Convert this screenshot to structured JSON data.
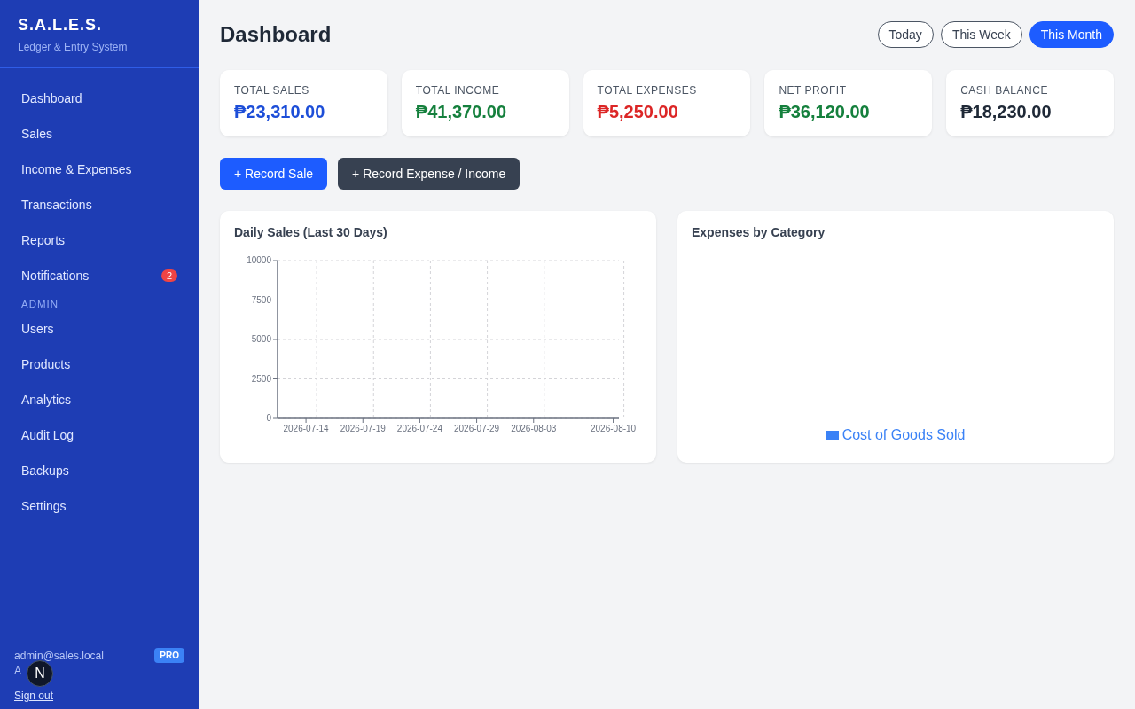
{
  "sidebar": {
    "brand": "S.A.L.E.S.",
    "tagline": "Ledger & Entry System",
    "items": [
      {
        "label": "Dashboard",
        "selected": false
      },
      {
        "label": "Sales",
        "selected": false
      },
      {
        "label": "Income & Expenses",
        "selected": false
      },
      {
        "label": "Transactions",
        "selected": false
      },
      {
        "label": "Reports",
        "selected": false
      },
      {
        "label": "Notifications",
        "selected": false,
        "badge": "2"
      }
    ],
    "section": "ADMIN",
    "admin_items": [
      {
        "label": "Users",
        "selected": false
      },
      {
        "label": "Products",
        "selected": false
      },
      {
        "label": "Analytics",
        "selected": false
      },
      {
        "label": "Audit Log",
        "selected": false
      },
      {
        "label": "Backups",
        "selected": false
      },
      {
        "label": "Settings",
        "selected": false
      }
    ],
    "user": {
      "email": "admin@sales.local",
      "plan": "PRO",
      "role": "A",
      "sign_out": "Sign out"
    },
    "dev_badge": "N"
  },
  "header": {
    "title": "Dashboard",
    "ranges": [
      {
        "label": "Today",
        "selected": false
      },
      {
        "label": "This Week",
        "selected": false
      },
      {
        "label": "This Month",
        "selected": true
      }
    ]
  },
  "stats": [
    {
      "label": "TOTAL SALES",
      "value": "₱23,310.00",
      "color": "#1d4ed8"
    },
    {
      "label": "TOTAL INCOME",
      "value": "₱41,370.00",
      "color": "#15803d"
    },
    {
      "label": "TOTAL EXPENSES",
      "value": "₱5,250.00",
      "color": "#dc2626"
    },
    {
      "label": "NET PROFIT",
      "value": "₱36,120.00",
      "color": "#15803d"
    },
    {
      "label": "CASH BALANCE",
      "value": "₱18,230.00",
      "color": "#1f2937"
    }
  ],
  "actions": [
    {
      "label": "+ Record Sale",
      "kind": "primary"
    },
    {
      "label": "+ Record Expense / Income",
      "kind": "dark"
    }
  ],
  "daily_sales": {
    "title": "Daily Sales (Last 30 Days)",
    "chart_data": {
      "type": "line",
      "grid": true,
      "ylim": [
        0,
        10000
      ],
      "yticks": [
        0,
        2500,
        5000,
        7500,
        10000
      ],
      "categories": [
        null,
        null,
        "2026-07-14",
        null,
        null,
        null,
        null,
        "2026-07-19",
        null,
        null,
        null,
        null,
        "2026-07-24",
        null,
        null,
        null,
        null,
        "2026-07-29",
        null,
        null,
        null,
        null,
        "2026-08-03",
        null,
        null,
        null,
        null,
        null,
        null,
        "2026-08-10"
      ]
    }
  },
  "expenses": {
    "title": "Expenses by Category",
    "legend": [
      {
        "label": "Cost of Goods Sold",
        "color": "#3b82f6"
      }
    ]
  }
}
